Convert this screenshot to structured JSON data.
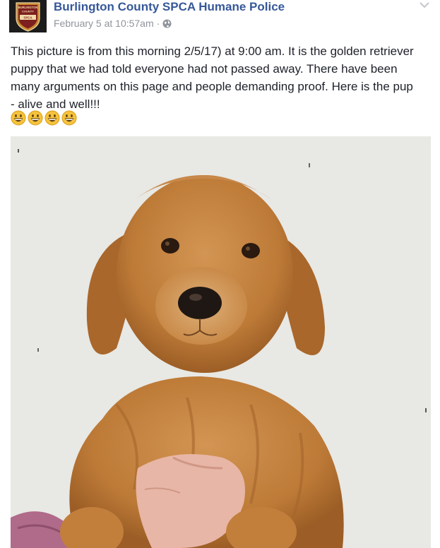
{
  "post": {
    "author": "Burlington County SPCA Humane Police",
    "timestamp": "February 5 at 10:57am",
    "separator": "·",
    "privacy_icon": "globe-icon",
    "menu_icon": "chevron-down-icon",
    "avatar_badge_lines": [
      "BURLINGTON",
      "COUNTY",
      "SPCA"
    ],
    "text_lines": [
      "This picture is from this morning 2/5/17) at 9:00 am. It is the golden retriever",
      "puppy that we had told everyone had not passed away. There have been",
      "many arguments on this page and people demanding proof. Here is the pup",
      "- alive and well!!!"
    ],
    "emojis": [
      "grinning-face-icon",
      "grinning-face-icon",
      "grinning-face-icon",
      "grinning-face-icon"
    ]
  },
  "colors": {
    "link": "#365899",
    "meta": "#90949c",
    "text": "#1d2129",
    "emoji_face": "#f5c33b",
    "photo_wall": "#ecebe8",
    "puppy_fur": "#c6843e",
    "shirt": "#b06a8a"
  }
}
